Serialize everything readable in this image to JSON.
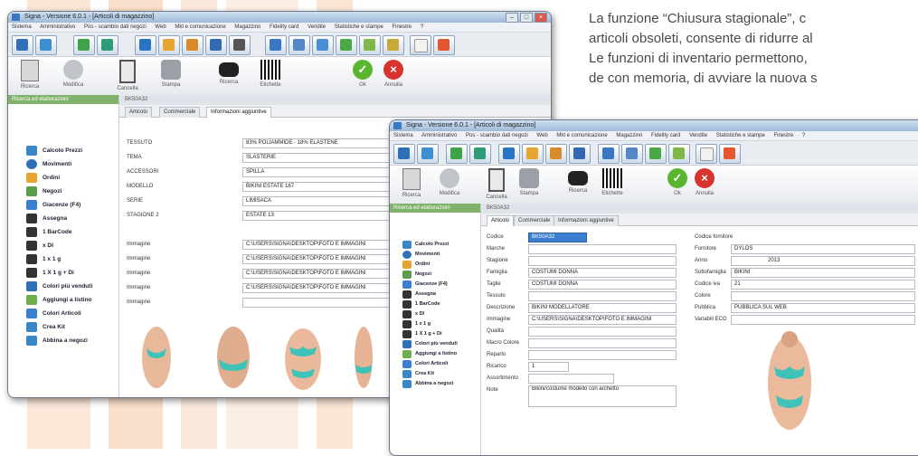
{
  "paragraph": {
    "lines": [
      "La funzione “Chiusura stagionale”, c",
      "articoli obsoleti, consente di ridurre al",
      "Le funzioni di inventario permettono,",
      "de con memoria, di avviare la nuova s"
    ]
  },
  "colors": {
    "background_stripes": "#f7d9c4",
    "window_border": "#6d7786",
    "sidebar_header": "#7fb26a",
    "ok_green": "#5ab52f",
    "cancel_red": "#d6342c",
    "highlight_blue": "#3a7fd1"
  },
  "window_back": {
    "title": "Signa - Versione 6.0.1 - [Articoli di magazzino]",
    "menu": [
      "Sistema",
      "Amministrativo",
      "Pos - scambio dati negozi",
      "Web",
      "Mkt e comunicazione",
      "Magazzino",
      "Fidelity card",
      "Vendite",
      "Statistiche e stampe",
      "Finestre",
      "?"
    ],
    "actions": [
      "Ricerca",
      "Modifica",
      "Cancella",
      "Stampa",
      "Ricerca",
      "Etichette",
      "Ok",
      "Annulla"
    ],
    "sidebar_title": "Ricerca ed elaborazioni",
    "sidebar_items": [
      "Calcolo Prezzi",
      "Movimenti",
      "Ordini",
      "Negozi",
      "Giacenze (F4)",
      "Assegna",
      "1 BarCode",
      "x DI",
      "1 x 1 g",
      "1 X 1 g + Di",
      "Colori più venduti",
      "Aggiungi a listino",
      "Colori Articoli",
      "Crea Kit",
      "Abbina a negozi"
    ],
    "code_value": "BK50A32",
    "tabs": [
      "Articolo",
      "Commerciale",
      "Informazioni aggiuntive"
    ],
    "fields": [
      {
        "label": "TESSUTO",
        "value": "83% POLIAMMIDE - 18% ELASTENE"
      },
      {
        "label": "TEMA",
        "value": "SLASTERIE"
      },
      {
        "label": "ACCESSORI",
        "value": "SPILLA"
      },
      {
        "label": "MODELLO",
        "value": "BIKINI ESTATE 167"
      },
      {
        "label": "SERIE",
        "value": "LIMISACA"
      },
      {
        "label": "STAGIONE 2",
        "value": "ESTATE 13"
      },
      {
        "label": "Immagine",
        "value": "C:\\USERS\\SIGNA\\DESKTOP\\FOTO E IMMAGINI"
      },
      {
        "label": "Immagine",
        "value": "C:\\USERS\\SIGNA\\DESKTOP\\FOTO E IMMAGINI"
      },
      {
        "label": "Immagine",
        "value": "C:\\USERS\\SIGNA\\DESKTOP\\FOTO E IMMAGINI"
      },
      {
        "label": "Immagine",
        "value": "C:\\USERS\\SIGNA\\DESKTOP\\FOTO E IMMAGINI"
      },
      {
        "label": "Immagine",
        "value": ""
      }
    ]
  },
  "window_front": {
    "title": "Signa - Versione 6.0.1 - [Articoli di magazzino]",
    "menu": [
      "Sistema",
      "Amministrativo",
      "Pos - scambio dati negozi",
      "Web",
      "Mkt e comunicazione",
      "Magazzino",
      "Fidelity card",
      "Vendite",
      "Statistiche e stampe",
      "Finestre",
      "?"
    ],
    "actions": [
      "Ricerca",
      "Modifica",
      "Cancella",
      "Stampa",
      "Ricerca",
      "Etichette",
      "Ok",
      "Annulla"
    ],
    "sidebar_title": "Ricerca ed elaborazioni",
    "sidebar_items": [
      "Calcolo Prezzi",
      "Movimenti",
      "Ordini",
      "Negozi",
      "Giacenze (F4)",
      "Assegna",
      "1 BarCode",
      "x DI",
      "1 x 1 g",
      "1 X 1 g + Di",
      "Colori più venduti",
      "Aggiungi a listino",
      "Colori Articoli",
      "Crea Kit",
      "Abbina a negozi"
    ],
    "code_value": "BK50A32",
    "tabs": [
      "Articolo",
      "Commerciale",
      "Informazioni aggiuntive"
    ],
    "left_fields": [
      {
        "label": "Codice",
        "value": "BK50A32"
      },
      {
        "label": "Marche",
        "value": ""
      },
      {
        "label": "Stagione",
        "value": ""
      },
      {
        "label": "Famiglia",
        "value": "COSTUMI DONNA"
      },
      {
        "label": "Taglie",
        "value": "COSTUMI DONNA"
      },
      {
        "label": "Tessuto",
        "value": ""
      },
      {
        "label": "Descrizione",
        "value": "BIKINI MODELLATORE"
      },
      {
        "label": "Immagine",
        "value": "C:\\USERS\\SIGNA\\DESKTOP\\FOTO E IMMAGINI"
      },
      {
        "label": "Qualità",
        "value": ""
      },
      {
        "label": "Macro Colore",
        "value": ""
      },
      {
        "label": "Reparto",
        "value": ""
      },
      {
        "label": "Ricarico",
        "value": "1"
      },
      {
        "label": "Assortimento",
        "value": ""
      },
      {
        "label": "Note",
        "value": "Bikini/costume modello con archetto"
      }
    ],
    "right_fields": [
      {
        "label": "Codice fornitore",
        "value": ""
      },
      {
        "label": "Fornitore",
        "value": "DYLOS"
      },
      {
        "label": "Anno",
        "value": "2013"
      },
      {
        "label": "Sottofamiglia",
        "value": "BIKINI"
      },
      {
        "label": "Codice iva",
        "value": "21"
      },
      {
        "label": "Colore",
        "value": ""
      },
      {
        "label": "Pubblica",
        "value": "PUBBLICA SUL WEB"
      },
      {
        "label": "Variabili ECO",
        "value": ""
      }
    ]
  }
}
